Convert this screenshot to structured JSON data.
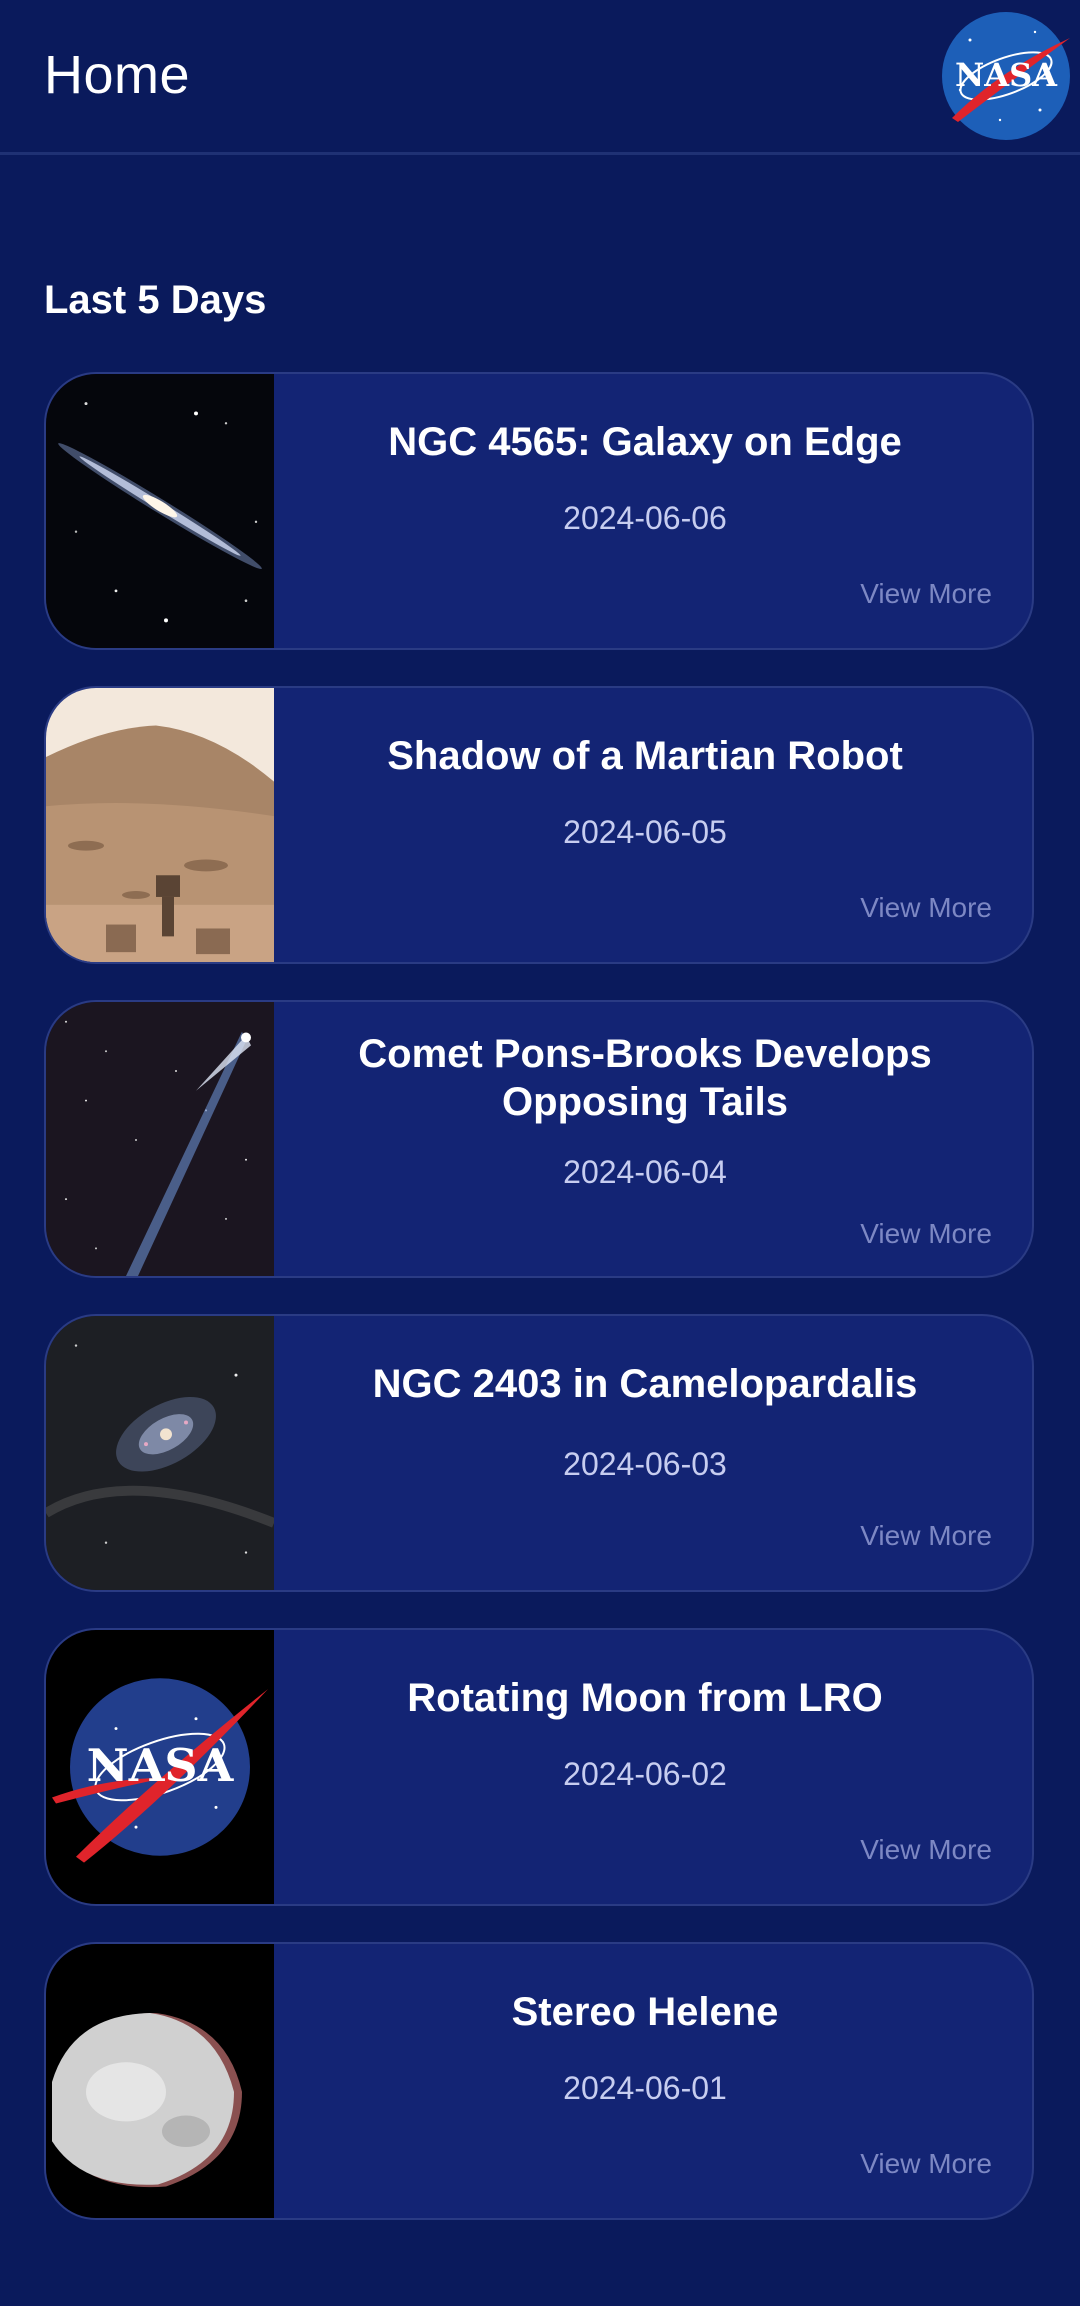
{
  "header": {
    "title": "Home",
    "logo_icon": "nasa-logo-icon"
  },
  "section": {
    "title": "Last 5 Days"
  },
  "cards": [
    {
      "title": "NGC 4565: Galaxy on Edge",
      "date": "2024-06-06",
      "more": "View More",
      "image_icon": "edge-galaxy-image"
    },
    {
      "title": "Shadow of a Martian Robot",
      "date": "2024-06-05",
      "more": "View More",
      "image_icon": "mars-landscape-image"
    },
    {
      "title": "Comet Pons-Brooks Develops Opposing Tails",
      "date": "2024-06-04",
      "more": "View More",
      "image_icon": "comet-image"
    },
    {
      "title": "NGC 2403 in Camelopardalis",
      "date": "2024-06-03",
      "more": "View More",
      "image_icon": "spiral-galaxy-image"
    },
    {
      "title": "Rotating Moon from LRO",
      "date": "2024-06-02",
      "more": "View More",
      "image_icon": "nasa-logo-icon"
    },
    {
      "title": "Stereo Helene",
      "date": "2024-06-01",
      "more": "View More",
      "image_icon": "moon-helene-image"
    }
  ],
  "colors": {
    "background": "#0a1a5c",
    "card": "#132474",
    "card_border": "#2a3b84",
    "date_text": "#c7cdf0",
    "view_more": "#7d88c4",
    "nasa_blue": "#1d5fb8",
    "nasa_red": "#e0242b"
  }
}
